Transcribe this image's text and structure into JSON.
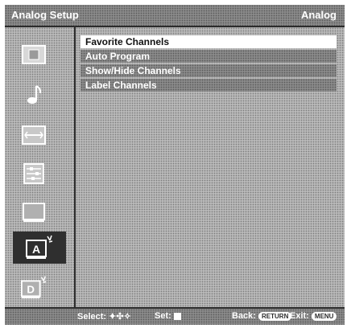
{
  "header": {
    "title": "Analog Setup",
    "mode": "Analog"
  },
  "sidebar": {
    "icons": [
      {
        "name": "picture-icon",
        "selected": false
      },
      {
        "name": "sound-icon",
        "selected": false
      },
      {
        "name": "screen-icon",
        "selected": false
      },
      {
        "name": "setup-icon",
        "selected": false
      },
      {
        "name": "channel-icon",
        "selected": false
      },
      {
        "name": "analog-setup-icon",
        "selected": true,
        "label": "A"
      },
      {
        "name": "digital-setup-icon",
        "selected": false,
        "label": "D"
      }
    ]
  },
  "menu": {
    "items": [
      {
        "label": "Favorite Channels",
        "active": true
      },
      {
        "label": "Auto Program",
        "active": false
      },
      {
        "label": "Show/Hide Channels",
        "active": false
      },
      {
        "label": "Label Channels",
        "active": false
      }
    ]
  },
  "footer": {
    "select_label": "Select:",
    "select_arrows": "✦✣✧",
    "set_label": "Set:",
    "back_label": "Back:",
    "back_button": "RETURN",
    "exit_label": "Exit:",
    "exit_button": "MENU"
  }
}
